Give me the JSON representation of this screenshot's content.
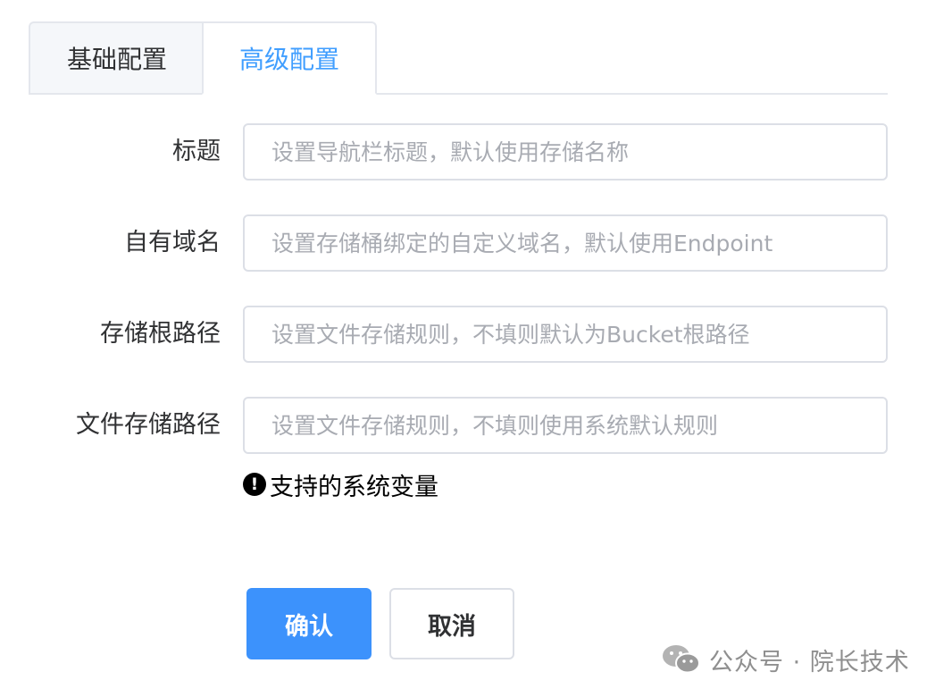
{
  "tabs": [
    {
      "label": "基础配置",
      "active": false
    },
    {
      "label": "高级配置",
      "active": true
    }
  ],
  "form": {
    "title": {
      "label": "标题",
      "placeholder": "设置导航栏标题，默认使用存储名称"
    },
    "domain": {
      "label": "自有域名",
      "placeholder": "设置存储桶绑定的自定义域名，默认使用Endpoint"
    },
    "root_path": {
      "label": "存储根路径",
      "placeholder": "设置文件存储规则，不填则默认为Bucket根路径"
    },
    "file_path": {
      "label": "文件存储路径",
      "placeholder": "设置文件存储规则，不填则使用系统默认规则"
    }
  },
  "hint": {
    "icon": "!",
    "text": "支持的系统变量"
  },
  "buttons": {
    "confirm": "确认",
    "cancel": "取消"
  },
  "watermark": {
    "icon": "wechat-icon",
    "text": "公众号 · 院长技术"
  },
  "colors": {
    "accent": "#409eff",
    "primary_button": "#3c92fc"
  }
}
